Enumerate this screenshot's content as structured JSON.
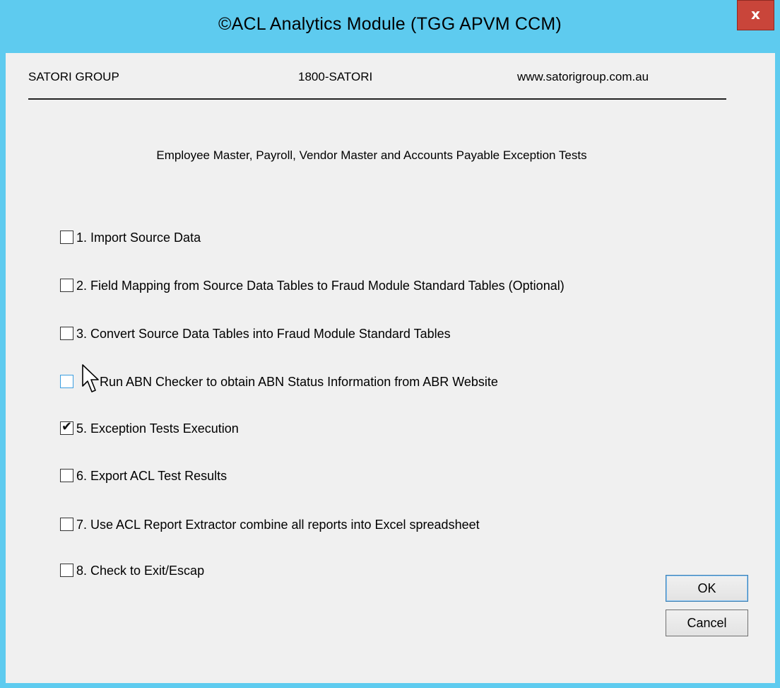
{
  "window": {
    "title": "©ACL Analytics Module (TGG APVM CCM)",
    "close_glyph": "x"
  },
  "header": {
    "company": "SATORI GROUP",
    "phone": "1800-SATORI",
    "website": "www.satorigroup.com.au"
  },
  "subtitle": "Employee Master, Payroll, Vendor Master and Accounts Payable Exception Tests",
  "options": [
    {
      "label": "1. Import Source Data",
      "checked": false
    },
    {
      "label": "2. Field Mapping from Source Data Tables to Fraud Module Standard Tables (Optional)",
      "checked": false
    },
    {
      "label": "3. Convert Source Data Tables into Fraud Module  Standard Tables",
      "checked": false
    },
    {
      "label": "Run ABN Checker to obtain ABN Status Information from ABR Website",
      "checked": false
    },
    {
      "label": "5. Exception Tests Execution",
      "checked": true
    },
    {
      "label": "6. Export ACL Test Results",
      "checked": false
    },
    {
      "label": "7. Use ACL Report Extractor combine all reports into Excel spreadsheet",
      "checked": false
    },
    {
      "label": "8. Check to Exit/Escap",
      "checked": false
    }
  ],
  "buttons": {
    "ok": "OK",
    "cancel": "Cancel"
  },
  "icons": {
    "checkbox_check": "checkmark-icon",
    "cursor": "arrow-cursor-icon"
  },
  "colors": {
    "titlebar": "#5ecbef",
    "close": "#c9453a",
    "client": "#f0f0f0"
  }
}
